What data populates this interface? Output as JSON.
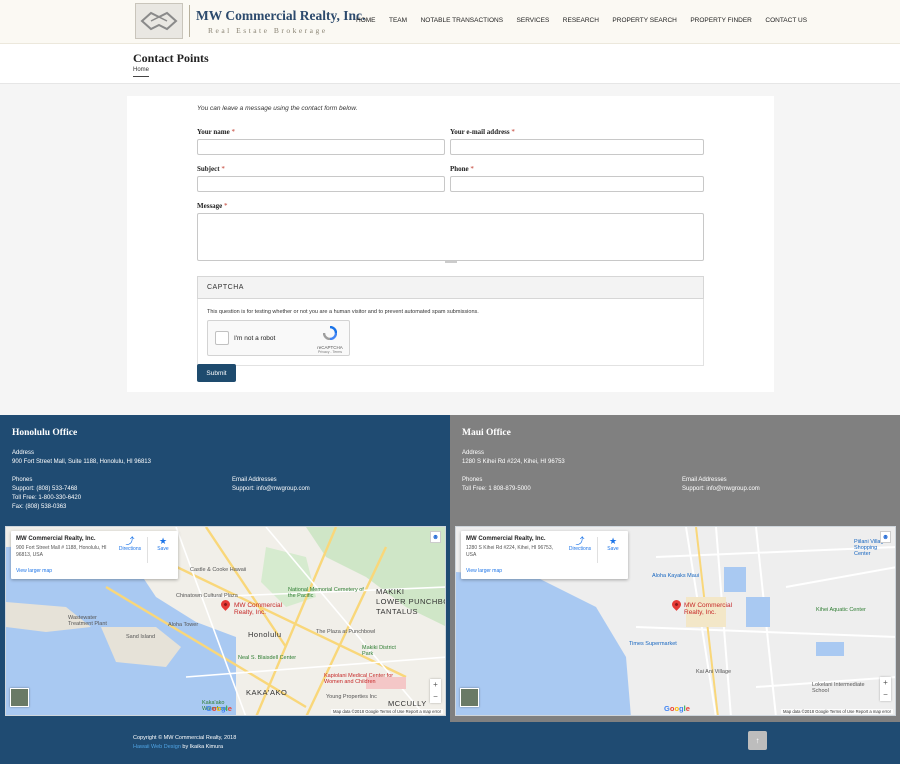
{
  "brand": {
    "name": "MW Commercial Realty, Inc.",
    "tagline": "Real Estate Brokerage"
  },
  "nav": [
    "HOME",
    "TEAM",
    "NOTABLE TRANSACTIONS",
    "SERVICES",
    "RESEARCH",
    "PROPERTY SEARCH",
    "PROPERTY FINDER",
    "CONTACT US"
  ],
  "page": {
    "title": "Contact Points",
    "breadcrumb": "Home"
  },
  "form": {
    "intro": "You can leave a message using the contact form below.",
    "name_label": "Your name",
    "email_label": "Your e-mail address",
    "subject_label": "Subject",
    "phone_label": "Phone",
    "message_label": "Message",
    "required_mark": "*",
    "captcha_title": "CAPTCHA",
    "captcha_note": "This question is for testing whether or not you are a human visitor and to prevent automated spam submissions.",
    "recaptcha_label": "I'm not a robot",
    "recaptcha_brand": "reCAPTCHA",
    "recaptcha_links": "Privacy - Terms",
    "submit_label": "Submit"
  },
  "offices": {
    "honolulu": {
      "title": "Honolulu Office",
      "address_label": "Address",
      "address": "900 Fort Street Mall, Suite 1188, Honolulu, HI 96813",
      "phones_label": "Phones",
      "phones": [
        "Support: (808) 533-7468",
        "Toll Free: 1-800-330-6420",
        "Fax: (808) 538-0363"
      ],
      "email_label": "Email Addresses",
      "email": "Support: info@mwgroup.com",
      "map": {
        "card_title": "MW Commercial Realty, Inc.",
        "card_address": "900 Fort Street Mall # 1188, Honolulu, HI 96813, USA",
        "directions": "Directions",
        "save": "Save",
        "larger": "View larger map",
        "pin_label": "MW Commercial Realty, Inc.",
        "attribution": "Map data ©2018 Google   Terms of Use   Report a map error",
        "labels": [
          "Castle & Cooke Hawaii",
          "Chinatown Cultural Plaza",
          "National Memorial Cemetery of the Pacific",
          "Wastewater Treatment Plant",
          "Aloha Tower",
          "Sand Island",
          "Honolulu",
          "The Plaza at Punchbowl",
          "Neal S. Blaisdell Center",
          "Kapiolani Medical Center for Women and Children",
          "Young Properties Inc",
          "MAKIKI",
          "LOWER PUNCHBOWL",
          "TANTALUS",
          "Makiki District Park",
          "KAKA'AKO",
          "Kaka'ako Waterfront",
          "MCCULLY"
        ]
      }
    },
    "maui": {
      "title": "Maui Office",
      "address_label": "Address",
      "address": "1280 S Kihei Rd #224, Kihei, HI 96753",
      "phones_label": "Phones",
      "phones": [
        "Toll Free: 1 808-879-5000"
      ],
      "email_label": "Email Addresses",
      "email": "Support: info@mwgroup.com",
      "map": {
        "card_title": "MW Commercial Realty, Inc.",
        "card_address": "1280 S Kihei Rd #224, Kihei, HI 96753, USA",
        "directions": "Directions",
        "save": "Save",
        "larger": "View larger map",
        "pin_label": "MW Commercial Realty, Inc.",
        "attribution": "Map data ©2018 Google   Terms of Use   Report a map error",
        "labels": [
          "Aloha Kayaks Maui",
          "Piilani Village Shopping Center",
          "Kihei Aquatic Center",
          "Times Supermarket",
          "Kai Ani Village",
          "Lokelani Intermediate School"
        ]
      }
    }
  },
  "footer": {
    "copyright": "Copyright © MW Commercial Realty, 2018",
    "design_link": "Hawaii Web Design",
    "design_by": " by Ikaika Kimura",
    "top_icon": "arrow-up-icon"
  },
  "colors": {
    "primary": "#1f4b72",
    "maui_bg": "#808080",
    "link": "#1a73e8",
    "pin": "#e53935"
  }
}
